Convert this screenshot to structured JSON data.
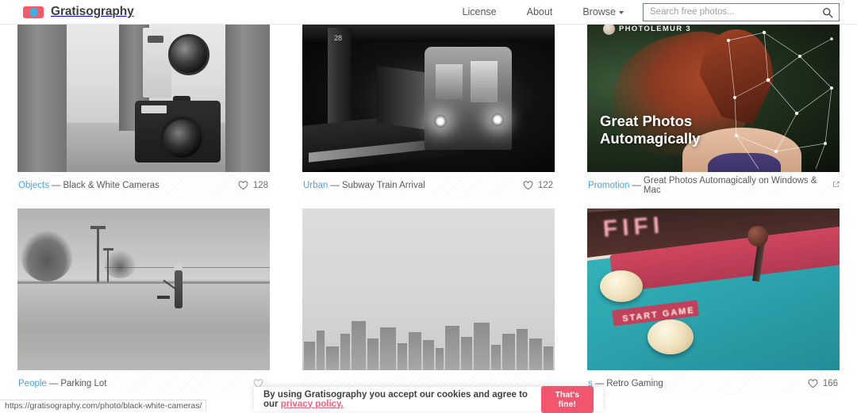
{
  "header": {
    "brand": "Gratisography",
    "logo_icon": "camera-logo-icon",
    "nav": [
      {
        "label": "License",
        "name": "nav-license"
      },
      {
        "label": "About",
        "name": "nav-about"
      },
      {
        "label": "Browse",
        "name": "nav-browse",
        "has_caret": true
      }
    ],
    "search": {
      "placeholder": "Search free photos...",
      "value": "",
      "icon": "search-icon"
    },
    "colors": {
      "logo_red": "#f25a67",
      "logo_blue": "#3fb0e0"
    }
  },
  "gallery": {
    "row1": [
      {
        "category": "Objects",
        "separator": "—",
        "title": "Black & White Cameras",
        "likes": "128",
        "alt": "Two vintage black and white film cameras stacked between stone blocks",
        "external": false
      },
      {
        "category": "Urban",
        "separator": "—",
        "title": "Subway Train Arrival",
        "likes": "122",
        "alt": "Dark black and white subway train arriving at station platform 28",
        "external": false
      },
      {
        "category": "Promotion",
        "separator": "—",
        "title": "Great Photos Automagically on Windows & Mac",
        "likes": "",
        "alt": "Photolemur 3 advertisement with red haired woman",
        "external": true,
        "ad": {
          "logo": "PHOTOLEMUR 3",
          "headline_line1": "Great Photos",
          "headline_line2": "Automagically"
        }
      }
    ],
    "row2": [
      {
        "category": "People",
        "separator": "—",
        "title": "Parking Lot",
        "likes": "",
        "alt": "Man sweeping an empty parking lot in black and white",
        "external": false
      },
      {
        "category": "",
        "separator": "",
        "title": "",
        "likes": "",
        "alt": "Hazy black and white city skyline",
        "external": false
      },
      {
        "category": "s",
        "separator": "—",
        "title": "Retro Gaming",
        "likes": "166",
        "alt": "Retro arcade cabinet control panel with joystick and cream buttons",
        "external": false
      }
    ]
  },
  "cookie_banner": {
    "message_before": "By using Gratisography you accept our cookies and agree to our ",
    "link_text": "privacy policy.",
    "button_label": "That's fine!",
    "accent": "#f2566e"
  },
  "status_bar": {
    "url": "https://gratisography.com/photo/black-white-cameras/"
  }
}
